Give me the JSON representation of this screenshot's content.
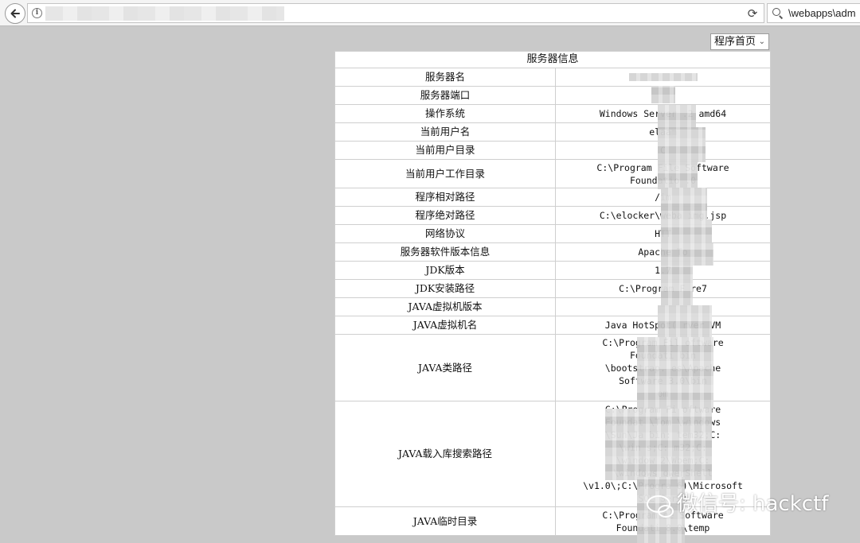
{
  "browser": {
    "search_text": "\\webapps\\adm"
  },
  "page_select": {
    "selected": "程序首页"
  },
  "table": {
    "title": "服务器信息",
    "rows": [
      {
        "label": "服务器名",
        "value": ""
      },
      {
        "label": "服务器端口",
        "value": ""
      },
      {
        "label": "操作系统",
        "value": "Windows Server .2 amd64"
      },
      {
        "label": "当前用户名",
        "value": "elaam"
      },
      {
        "label": "当前用户目录",
        "value": "C"
      },
      {
        "label": "当前用户工作目录",
        "value": "C:\\Program File Software\nFoundatio .0"
      },
      {
        "label": "程序相对路径",
        "value": "/im"
      },
      {
        "label": "程序绝对路径",
        "value": "C:\\elocker\\weba img.jsp"
      },
      {
        "label": "网络协议",
        "value": "HTT"
      },
      {
        "label": "服务器软件版本信息",
        "value": "Apache To"
      },
      {
        "label": "JDK版本",
        "value": "1.7"
      },
      {
        "label": "JDK安装路径",
        "value": "C:\\Program F re7"
      },
      {
        "label": "JAVA虚拟机版本",
        "value": ""
      },
      {
        "label": "JAVA虚拟机名",
        "value": "Java HotSpot( rver VM"
      },
      {
        "label": "JAVA类路径",
        "value": "C:\\Program Fil oftware\nFoundati bin\n\\bootstrap. es\\Apache\nSoftware 3.0\\bin\nom"
      },
      {
        "label": "JAVA载入库搜索路径",
        "value": "C:\\Program Fi oftware\nFoundat \\Tom \\windows\n\\Sun\\Ja bin: tem32;C:\n\\win s;C: m32;C:\n\\window 2\\Wbem;C:\n\\windows owerShell\n\\v1.0\\;C:\\Progra 6)\\Microsoft\nSQL Serve"
      },
      {
        "label": "JAVA临时目录",
        "value": "C:\\Program ne Software\nFoundati 8.0\\temp"
      }
    ]
  },
  "watermark": {
    "text": "微信号: hackctf"
  }
}
